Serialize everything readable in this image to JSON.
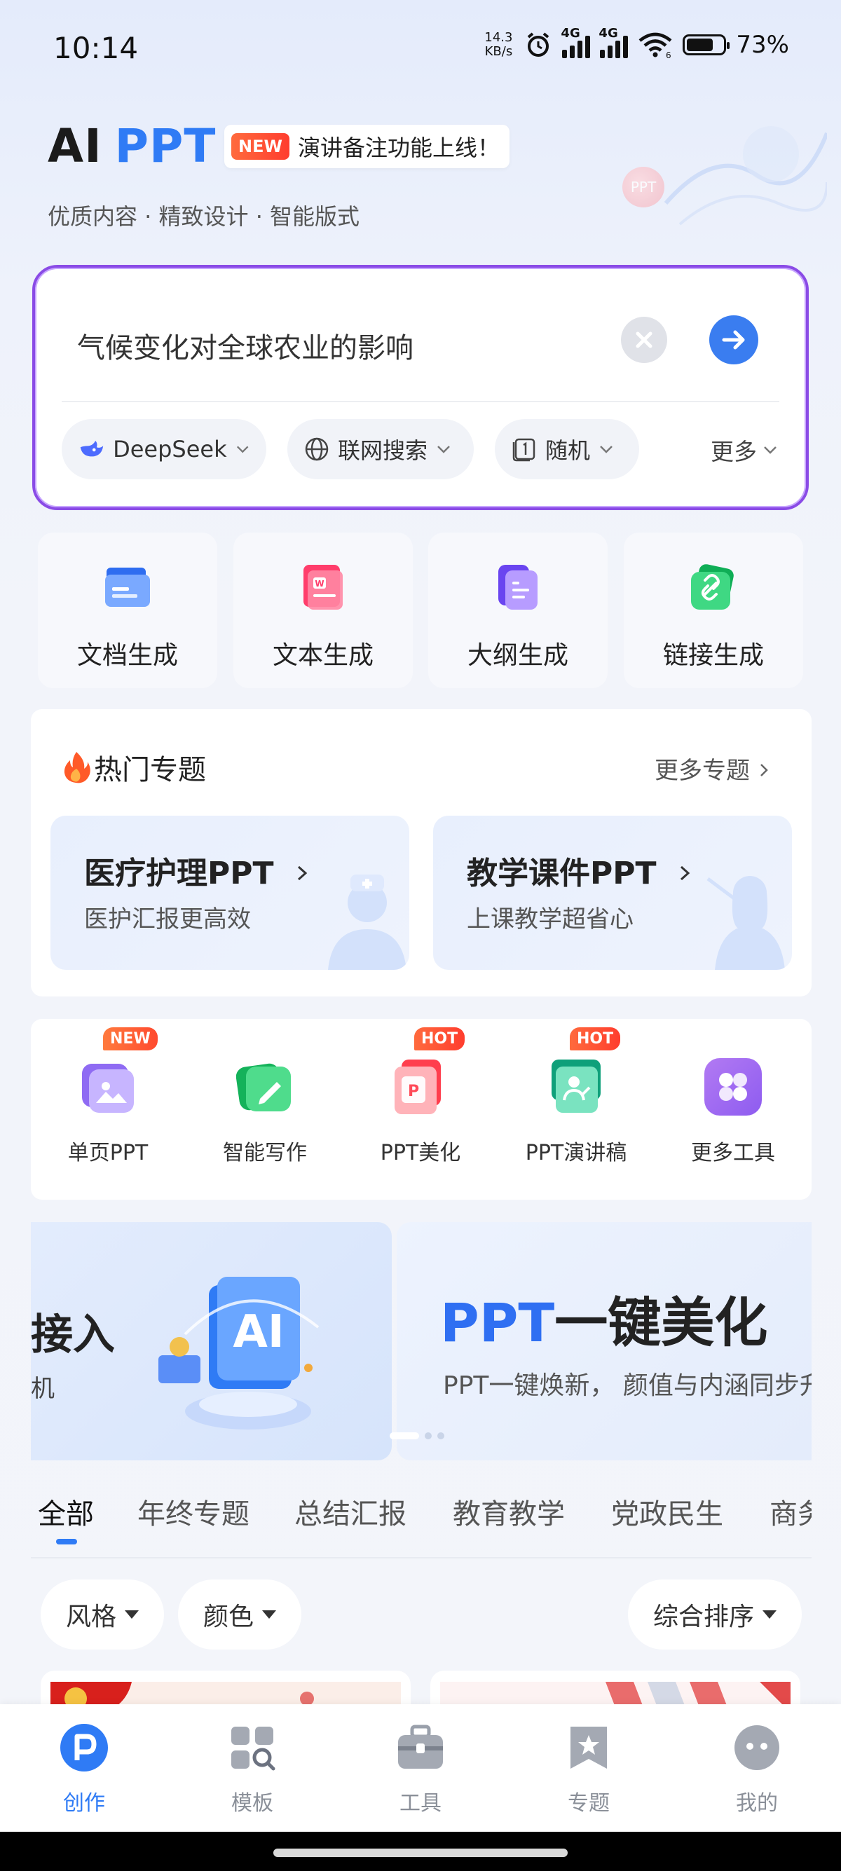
{
  "status_bar": {
    "time": "10:14",
    "net_speed_value": "14.3",
    "net_speed_unit": "KB/s",
    "sim1": "4G",
    "sim2": "4G",
    "wifi_label": "6",
    "battery": "73%"
  },
  "header": {
    "logo_ai": "AI",
    "logo_ppt": "PPT",
    "new_tag": "NEW",
    "announcement": "演讲备注功能上线！",
    "subtitle": "优质内容 · 精致设计 · 智能版式",
    "deco_label": "PPT"
  },
  "search": {
    "query": "气候变化对全球农业的影响",
    "chips": [
      {
        "label": "DeepSeek",
        "icon": "deepseek-whale-icon"
      },
      {
        "label": "联网搜索",
        "icon": "globe-icon"
      },
      {
        "label": "随机",
        "icon": "page-one-icon"
      }
    ],
    "more_label": "更多"
  },
  "quick_actions": [
    {
      "label": "文档生成",
      "icon": "folder-doc-icon",
      "color": "#4f8ef7"
    },
    {
      "label": "文本生成",
      "icon": "word-doc-icon",
      "color": "#ff4f7b"
    },
    {
      "label": "大纲生成",
      "icon": "outline-doc-icon",
      "color": "#8a5cf6"
    },
    {
      "label": "链接生成",
      "icon": "link-doc-icon",
      "color": "#22c36b"
    }
  ],
  "hot_topics": {
    "title": "热门专题",
    "more": "更多专题",
    "cards": [
      {
        "title": "医疗护理PPT",
        "subtitle": "医护汇报更高效"
      },
      {
        "title": "教学课件PPT",
        "subtitle": "上课教学超省心"
      }
    ]
  },
  "tools": [
    {
      "label": "单页PPT",
      "badge": "NEW",
      "icon": "single-page-icon",
      "color": "#9b7cf7"
    },
    {
      "label": "智能写作",
      "badge": "",
      "icon": "pen-write-icon",
      "color": "#2cc36b"
    },
    {
      "label": "PPT美化",
      "badge": "HOT",
      "icon": "ppt-beautify-icon",
      "color": "#ff5a6a"
    },
    {
      "label": "PPT演讲稿",
      "badge": "HOT",
      "icon": "speech-script-icon",
      "color": "#1fb98a"
    },
    {
      "label": "更多工具",
      "badge": "",
      "icon": "grid-more-icon",
      "color": "#a56cf0"
    }
  ],
  "carousel": {
    "slide1_title": "接入",
    "slide1_sub": "机",
    "slide1_art": "AI",
    "slide2_title_blue": "PPT",
    "slide2_title_rest": "一键美化",
    "slide2_sub": "PPT一键焕新， 颜值与内涵同步升"
  },
  "category_tabs": [
    "全部",
    "年终专题",
    "总结汇报",
    "教育教学",
    "党政民生",
    "商务"
  ],
  "filters": {
    "style": "风格",
    "color": "颜色",
    "sort": "综合排序"
  },
  "bottom_nav": [
    {
      "label": "创作",
      "icon": "create-p-icon",
      "active": true
    },
    {
      "label": "模板",
      "icon": "template-grid-icon",
      "active": false
    },
    {
      "label": "工具",
      "icon": "toolbox-icon",
      "active": false
    },
    {
      "label": "专题",
      "icon": "bookmark-star-icon",
      "active": false
    },
    {
      "label": "我的",
      "icon": "profile-face-icon",
      "active": false
    }
  ],
  "colors": {
    "accent": "#2f7bf5",
    "search_border": "#8a4be6",
    "hot_badge": "#ff3d2e"
  }
}
